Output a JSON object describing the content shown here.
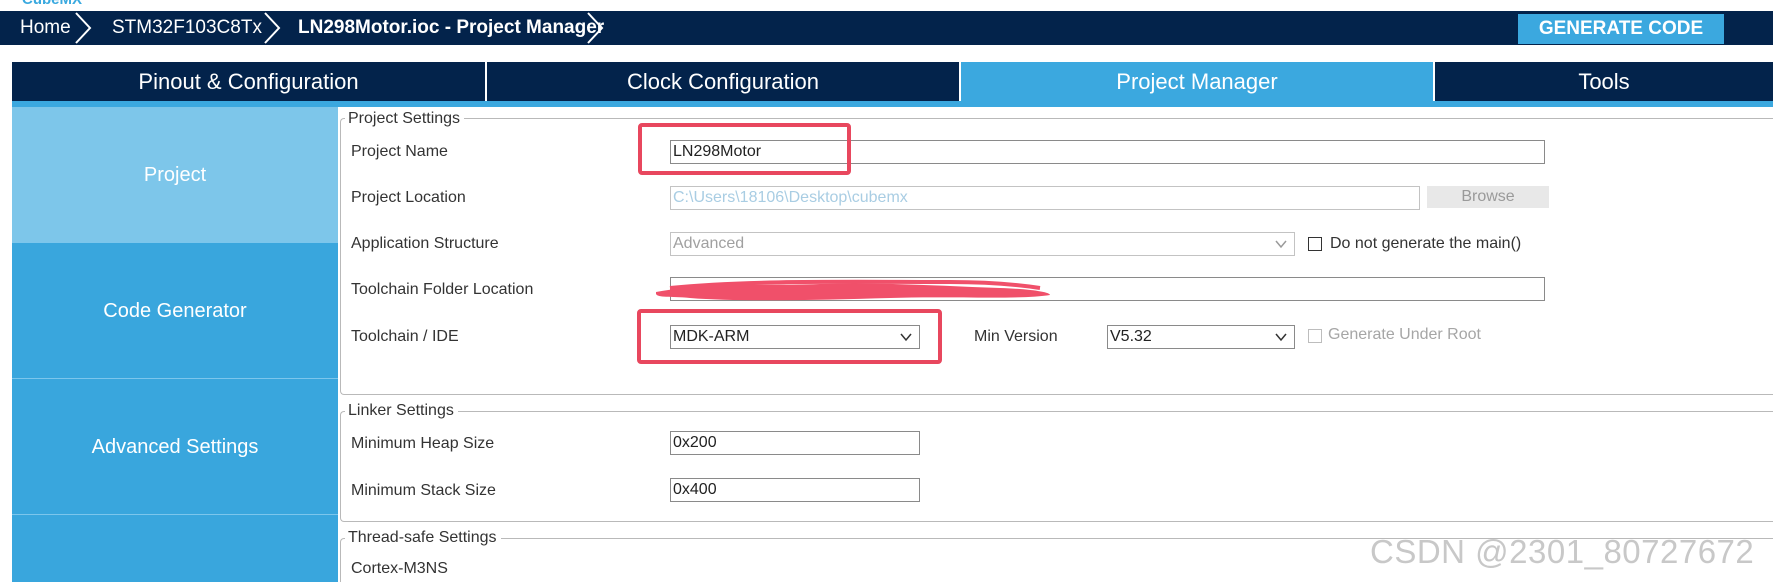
{
  "app": {
    "logo": "CubeMX"
  },
  "breadcrumb": {
    "items": [
      {
        "label": "Home"
      },
      {
        "label": "STM32F103C8Tx"
      },
      {
        "label": "LN298Motor.ioc - Project Manager"
      }
    ]
  },
  "toolbar": {
    "generate_label": "GENERATE CODE"
  },
  "tabs": [
    {
      "label": "Pinout & Configuration"
    },
    {
      "label": "Clock Configuration"
    },
    {
      "label": "Project Manager",
      "active": true
    },
    {
      "label": "Tools"
    }
  ],
  "sidebar": {
    "items": [
      {
        "label": "Project",
        "active": true
      },
      {
        "label": "Code Generator"
      },
      {
        "label": "Advanced Settings"
      }
    ]
  },
  "project_settings": {
    "legend": "Project Settings",
    "project_name": {
      "label": "Project Name",
      "value": "LN298Motor"
    },
    "project_location": {
      "label": "Project Location",
      "value": "C:\\Users\\18106\\Desktop\\cubemx",
      "browse_label": "Browse"
    },
    "application_structure": {
      "label": "Application Structure",
      "value": "Advanced",
      "checkbox_label": "Do not generate the main()"
    },
    "toolchain_folder": {
      "label": "Toolchain Folder Location",
      "value": ""
    },
    "toolchain_ide": {
      "label": "Toolchain / IDE",
      "value": "MDK-ARM"
    },
    "min_version": {
      "label": "Min Version",
      "value": "V5.32"
    },
    "generate_under_root": {
      "label": "Generate Under Root"
    }
  },
  "linker_settings": {
    "legend": "Linker Settings",
    "heap": {
      "label": "Minimum Heap Size",
      "value": "0x200"
    },
    "stack": {
      "label": "Minimum Stack Size",
      "value": "0x400"
    }
  },
  "thread_safe_settings": {
    "legend": "Thread-safe Settings",
    "core": "Cortex-M3NS"
  },
  "watermark": "CSDN @2301_80727672",
  "colors": {
    "navy": "#03234b",
    "accent": "#3ba8df",
    "sidebar_active": "#7dc6ea",
    "highlight": "#e8475e"
  }
}
